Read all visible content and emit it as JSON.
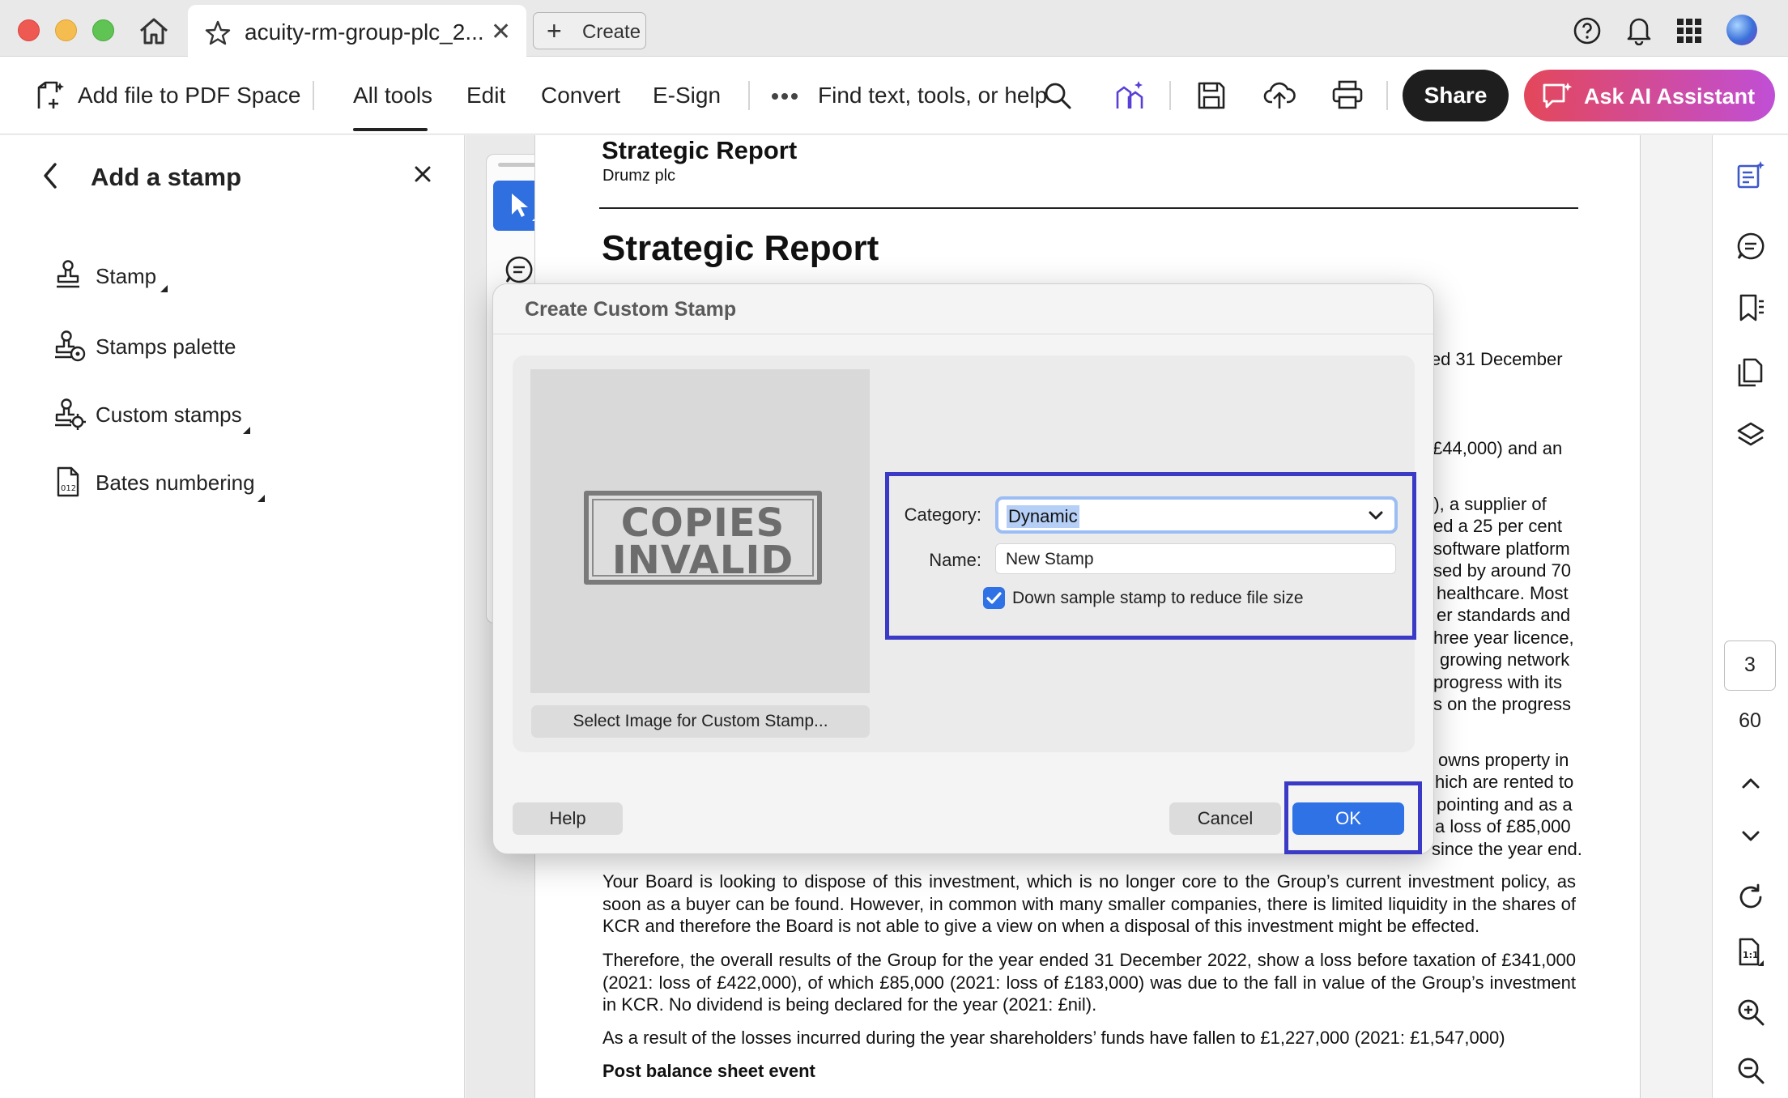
{
  "browser": {
    "tab_title": "acuity-rm-group-plc_2...",
    "create_label": "Create"
  },
  "toolbar": {
    "add_file": "Add file to PDF Space",
    "all_tools": "All tools",
    "edit": "Edit",
    "convert": "Convert",
    "esign": "E-Sign",
    "find": "Find text, tools, or help",
    "share": "Share",
    "ai": "Ask AI Assistant"
  },
  "panel": {
    "title": "Add a stamp",
    "items": [
      {
        "label": "Stamp"
      },
      {
        "label": "Stamps palette"
      },
      {
        "label": "Custom stamps"
      },
      {
        "label": "Bates numbering"
      }
    ]
  },
  "document": {
    "header_title": "Strategic Report",
    "header_sub": "Drumz plc",
    "heading": "Strategic Report",
    "fragments": [
      "led 31 December",
      "£44,000) and an",
      "”), a supplier of",
      "ed a 25 per cent",
      "software platform",
      "sed by around 70",
      "healthcare. Most",
      "er standards and",
      "hree year licence,",
      "growing network",
      "progress with its",
      "s on the progress",
      "owns property in",
      "hich are rented to",
      "pointing and as a",
      "a loss of £85,000",
      "since the year end."
    ],
    "para1": "Your Board is looking to dispose of this investment, which is no longer core to the Group’s current investment policy, as soon as a buyer can be found. However, in common with many smaller companies, there is limited liquidity in the shares of KCR and therefore the Board is not able to give a view on when a disposal of this investment might be effected.",
    "para2": "Therefore, the overall results of the Group for the year ended 31 December 2022, show a loss before taxation of £341,000 (2021: loss of £422,000), of which £85,000 (2021: loss of £183,000) was due to the fall in value of the Group’s investment in KCR. No dividend is being declared for the year (2021: £nil).",
    "para3": "As a result of the losses incurred during the year shareholders’ funds have fallen to £1,227,000 (2021: £1,547,000)",
    "bold_heading": "Post balance sheet event"
  },
  "dialog": {
    "title": "Create Custom Stamp",
    "stamp_line1": "COPIES",
    "stamp_line2": "INVALID",
    "select_image": "Select Image for Custom Stamp...",
    "category_label": "Category:",
    "category_value": "Dynamic",
    "name_label": "Name:",
    "name_value": "New Stamp",
    "downsample_label": "Down sample stamp to reduce file size",
    "downsample_checked": true,
    "help": "Help",
    "cancel": "Cancel",
    "ok": "OK"
  },
  "pager": {
    "current": "3",
    "total": "60"
  },
  "colors": {
    "accent_blue": "#2f72e6",
    "highlight_box": "#3a3ac7",
    "ai_gradient_start": "#e3475a",
    "ai_gradient_end": "#c04fd6"
  }
}
